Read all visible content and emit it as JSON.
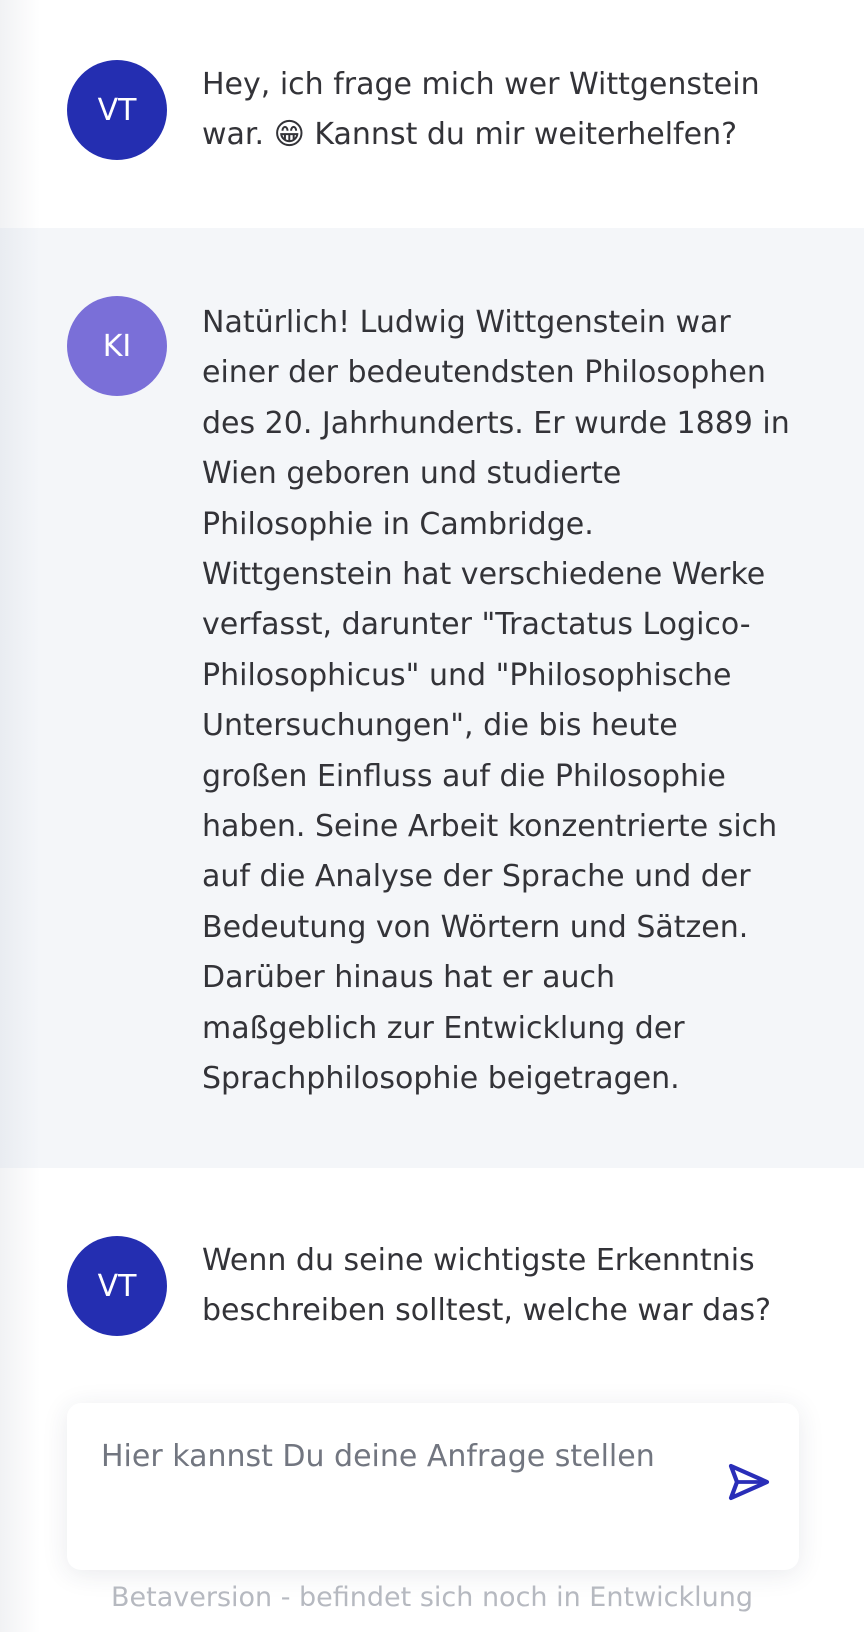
{
  "messages": [
    {
      "role": "user",
      "avatar": "VT",
      "text": "Hey, ich frage mich wer Wittgenstein\nwar. 😁 Kannst du mir weiterhelfen?"
    },
    {
      "role": "assistant",
      "avatar": "KI",
      "text": "Natürlich! Ludwig Wittgenstein war\neiner der bedeutendsten Philosophen\ndes 20. Jahrhunderts. Er wurde 1889 in\nWien geboren und studierte\nPhilosophie in Cambridge.\nWittgenstein hat verschiedene Werke\nverfasst, darunter \"Tractatus Logico-\nPhilosophicus\" und \"Philosophische\nUntersuchungen\", die bis heute\ngroßen Einfluss auf die Philosophie\nhaben. Seine Arbeit konzentrierte sich\nauf die Analyse der Sprache und der\nBedeutung von Wörtern und Sätzen.\nDarüber hinaus hat er auch\nmaßgeblich zur Entwicklung der\nSprachphilosophie beigetragen."
    },
    {
      "role": "user",
      "avatar": "VT",
      "text": "Wenn du seine wichtigste Erkenntnis\nbeschreiben solltest, welche war das?"
    }
  ],
  "composer": {
    "placeholder": "Hier kannst Du deine Anfrage stellen",
    "value": "",
    "send_icon": "send-icon"
  },
  "footer": {
    "note": "Betaversion - befindet sich noch in Entwicklung"
  },
  "colors": {
    "user_avatar": "#242eb1",
    "ai_avatar": "#7a6fd8",
    "accent": "#2a2eb8"
  }
}
